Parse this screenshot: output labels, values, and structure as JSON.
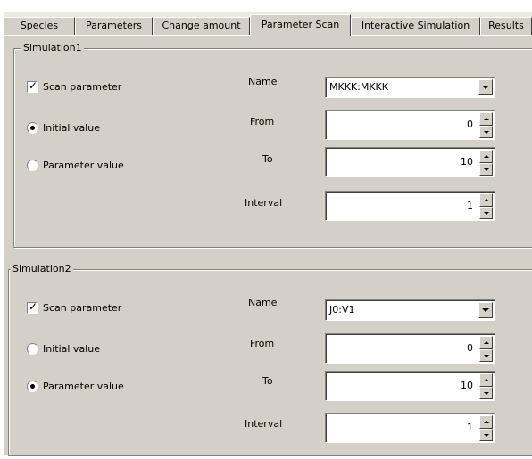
{
  "tabs": [
    {
      "label": "Species"
    },
    {
      "label": "Parameters"
    },
    {
      "label": "Change amount"
    },
    {
      "label": "Parameter Scan",
      "active": true
    },
    {
      "label": "Interactive Simulation"
    },
    {
      "label": "Results"
    }
  ],
  "simulations": [
    {
      "title": "Simulation1",
      "scan_parameter": {
        "label": "Scan parameter",
        "checked": true
      },
      "initial_value": {
        "label": "Initial value",
        "selected": true
      },
      "parameter_value": {
        "label": "Parameter value",
        "selected": false
      },
      "name_label": "Name",
      "name_value": "MKKK:MKKK",
      "from_label": "From",
      "from_value": "0",
      "to_label": "To",
      "to_value": "10",
      "interval_label": "Interval",
      "interval_value": "1"
    },
    {
      "title": "Simulation2",
      "scan_parameter": {
        "label": "Scan parameter",
        "checked": true
      },
      "initial_value": {
        "label": "Initial value",
        "selected": false
      },
      "parameter_value": {
        "label": "Parameter value",
        "selected": true
      },
      "name_label": "Name",
      "name_value": "J0:V1",
      "from_label": "From",
      "from_value": "0",
      "to_label": "To",
      "to_value": "10",
      "interval_label": "Interval",
      "interval_value": "1"
    }
  ]
}
